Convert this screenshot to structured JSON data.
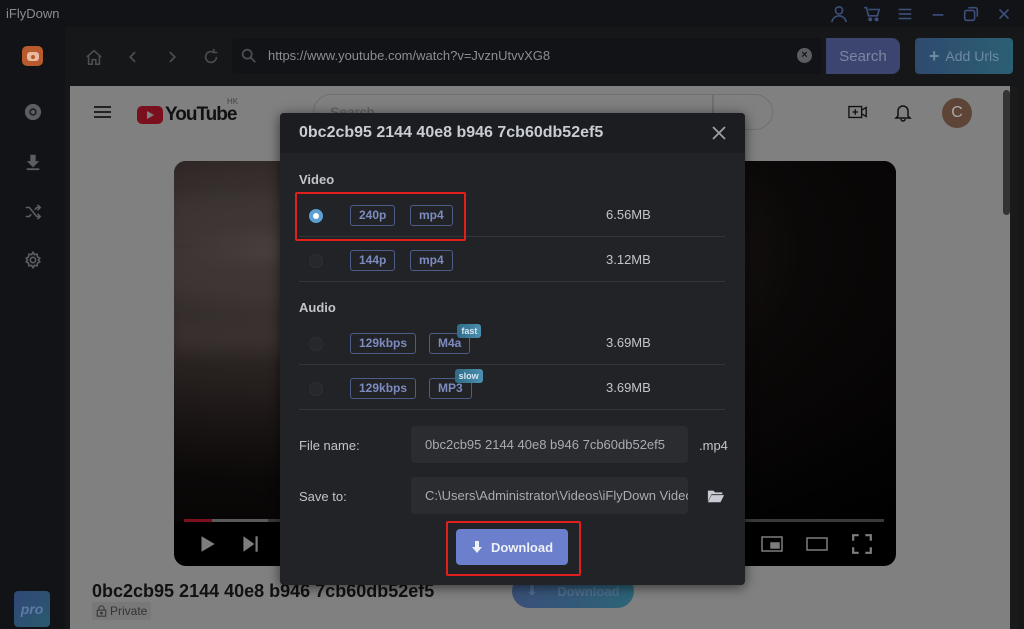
{
  "app": {
    "title": "iFlyDown"
  },
  "window_controls": [
    "user-icon",
    "cart-icon",
    "menu-icon",
    "minimize-icon",
    "restore-icon",
    "close-icon"
  ],
  "sidebar": {
    "items": [
      {
        "name": "logo",
        "icon": "app-logo-icon"
      },
      {
        "name": "browser",
        "icon": "chrome-icon"
      },
      {
        "name": "downloads",
        "icon": "download-icon"
      },
      {
        "name": "convert",
        "icon": "shuffle-icon"
      },
      {
        "name": "settings",
        "icon": "gear-icon"
      }
    ],
    "pro_label": "pro"
  },
  "toolbar": {
    "url": "https://www.youtube.com/watch?v=JvznUtvvXG8",
    "search_label": "Search",
    "add_urls_label": "Add Urls"
  },
  "youtube": {
    "logo_text": "YouTube",
    "region": "HK",
    "search_placeholder": "Search",
    "avatar_letter": "C",
    "video_title": "0bc2cb95 2144 40e8 b946 7cb60db52ef5",
    "privacy": "Private",
    "download_label": "Download",
    "progress": {
      "played_fraction": 0.04,
      "buffered_fraction": 0.12
    }
  },
  "dialog": {
    "title": "0bc2cb95 2144 40e8 b946 7cb60db52ef5",
    "video_label": "Video",
    "audio_label": "Audio",
    "video_options": [
      {
        "quality": "240p",
        "format": "mp4",
        "size": "6.56MB",
        "selected": true
      },
      {
        "quality": "144p",
        "format": "mp4",
        "size": "3.12MB",
        "selected": false
      }
    ],
    "audio_options": [
      {
        "quality": "129kbps",
        "format": "M4a",
        "badge": "fast",
        "size": "3.69MB",
        "selected": false
      },
      {
        "quality": "129kbps",
        "format": "MP3",
        "badge": "slow",
        "size": "3.69MB",
        "selected": false
      }
    ],
    "file_name_label": "File name:",
    "file_name_value": "0bc2cb95 2144 40e8 b946 7cb60db52ef5",
    "extension": ".mp4",
    "save_to_label": "Save to:",
    "save_to_value": "C:\\Users\\Administrator\\Videos\\iFlyDown Video",
    "download_label": "Download"
  },
  "colors": {
    "accent": "#6b7fcc",
    "highlight": "#e0201c",
    "radio_selected": "#5b9fd3"
  }
}
